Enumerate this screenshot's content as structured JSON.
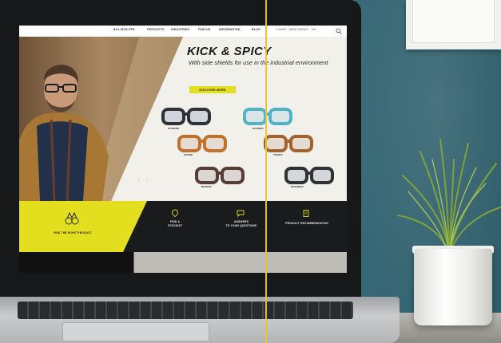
{
  "site": {
    "nav": [
      "BILLINGS PPE",
      "PRODUCTS",
      "INDUSTRIES",
      "FIND US",
      "INFORMATION",
      "BLOG"
    ],
    "nav_right": [
      "LOGIN",
      "MEN SIGNUP",
      "EN"
    ],
    "hero": {
      "title": "KICK & SPICY",
      "subtitle": "With side shields for use in the industrial environment",
      "cta": "DISCOVER MORE"
    },
    "glasses_labels": [
      "SCREWS",
      "SHADES",
      "STONE",
      "TONGS",
      "BRIDGE",
      "SPANNER"
    ],
    "carousel": {
      "prev": "‹",
      "next": "›"
    },
    "features": [
      {
        "label": "FIND THE RIGHT PRODUCT",
        "icon": "binoculars-icon"
      },
      {
        "label": "FIND A\nSTOCKIST",
        "icon": "location-pin-icon"
      },
      {
        "label": "ANSWERS\nTO YOUR QUESTIONS",
        "icon": "chat-icon"
      },
      {
        "label": "PRODUCT RECOMMENDATION",
        "icon": "clipboard-icon"
      }
    ]
  },
  "colors": {
    "wall": "#3c6f7d",
    "accent_yellow": "#e3df1f",
    "guide_line": "#e8c62d"
  }
}
